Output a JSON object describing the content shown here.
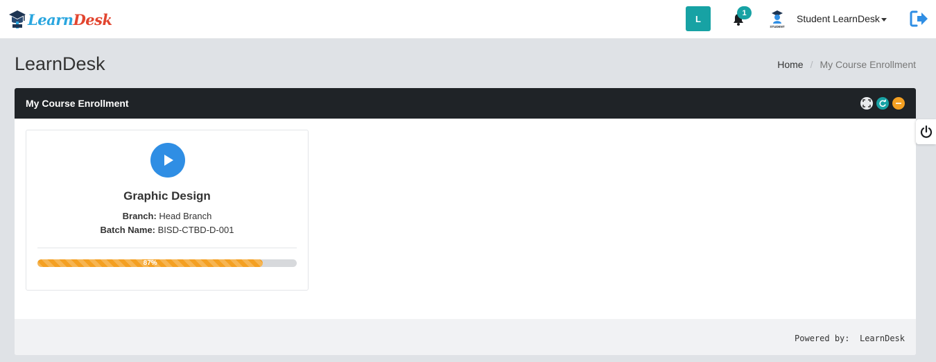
{
  "brand": {
    "logo_part1": "Learn",
    "logo_part2": "Desk",
    "accent": "#17a2a4",
    "primary": "#2f8ee4",
    "warning": "#f4a022"
  },
  "header": {
    "user_initial": "L",
    "notification_count": "1",
    "user_name": "Student LearnDesk",
    "avatar_caption": "STUDENT"
  },
  "page": {
    "title": "LearnDesk",
    "breadcrumb": {
      "home": "Home",
      "separator": "/",
      "current": "My Course Enrollment"
    }
  },
  "panel": {
    "title": "My Course Enrollment",
    "courses": [
      {
        "name": "Graphic Design",
        "branch_label": "Branch:",
        "branch_value": "Head Branch",
        "batch_label": "Batch Name:",
        "batch_value": "BISD-CTBD-D-001",
        "progress_percent": 87,
        "progress_label": "87%"
      }
    ],
    "footer": {
      "powered_label": "Powered by:",
      "powered_value": "LearnDesk"
    }
  }
}
